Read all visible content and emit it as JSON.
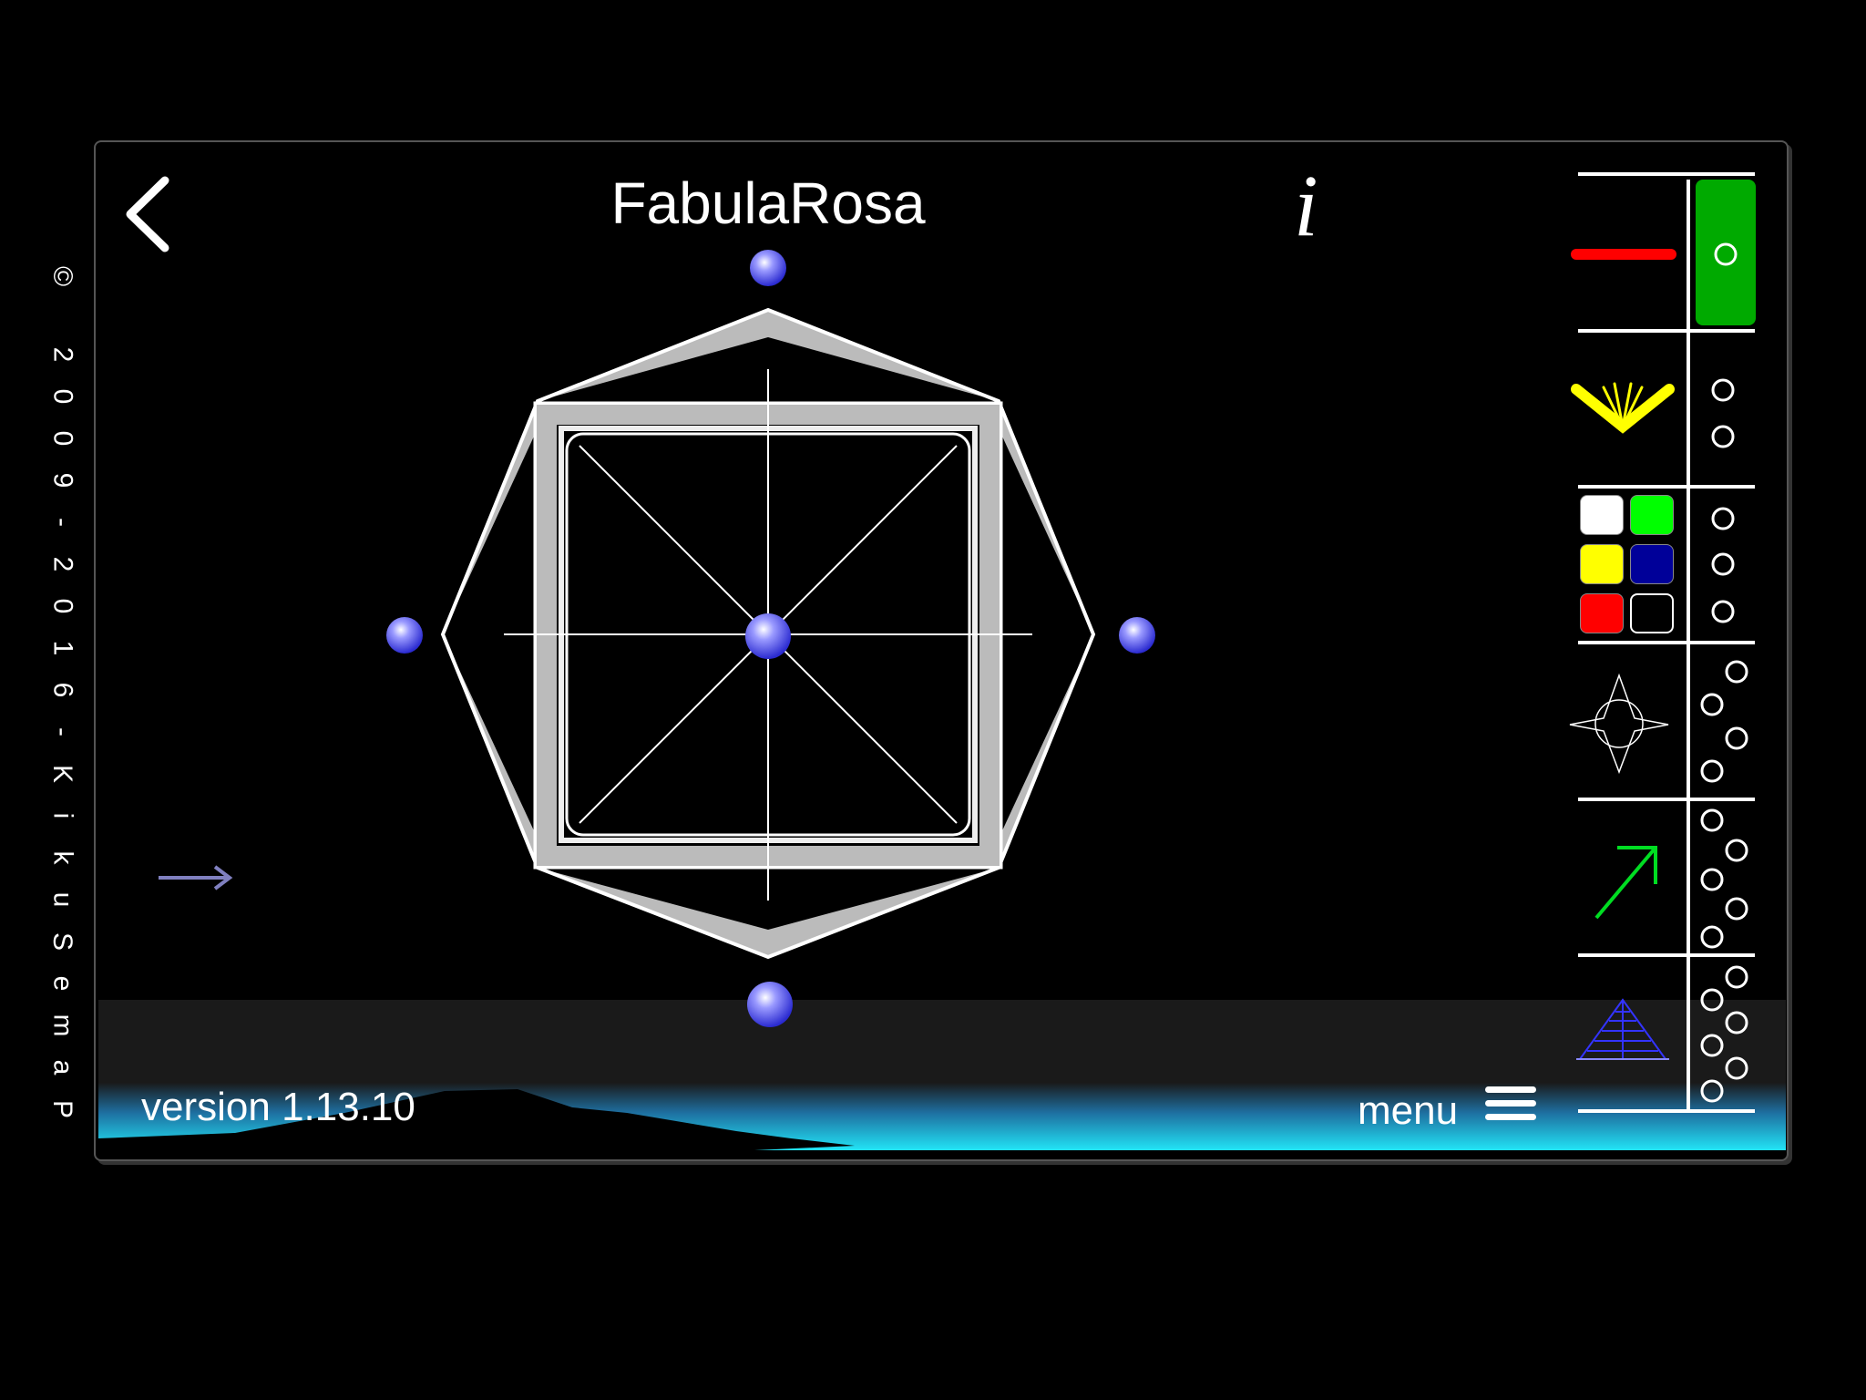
{
  "app": {
    "title": "FabulaRosa",
    "info_label": "i",
    "version_label": "version 1.13.10",
    "menu_label": "menu",
    "copyright_text": "© 2009-2016-KikuSemaP"
  },
  "icons": {
    "back": "chevron-left-icon",
    "info": "info-icon",
    "menu": "hamburger-icon",
    "arrow": "arrow-right-icon"
  },
  "palette": {
    "colors": [
      "#ffffff",
      "#00ff00",
      "#ffff00",
      "#000099",
      "#ff0000",
      "#000000"
    ]
  },
  "accent": {
    "line_color": "#ff0000",
    "active_toggle": "#00aa00",
    "handle_color": "#6666ff",
    "band_color": "#22ddf0"
  }
}
